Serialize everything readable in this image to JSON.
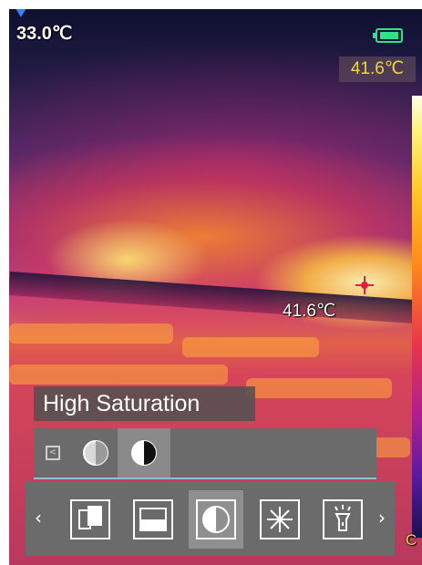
{
  "status": {
    "min_temp": "33.0℃",
    "max_temp": "41.6℃",
    "spot_temp": "41.6℃",
    "battery_icon": "battery-icon",
    "edge_fragment": "C"
  },
  "palette": {
    "label": "High Saturation"
  },
  "submenu": {
    "items": [
      {
        "name": "back-icon",
        "label": "<"
      },
      {
        "name": "half-contrast-icon"
      },
      {
        "name": "high-contrast-icon",
        "selected": true
      }
    ]
  },
  "toolbar": {
    "prev": "‹",
    "next": "›",
    "items": [
      {
        "name": "picture-in-picture-icon"
      },
      {
        "name": "split-screen-icon"
      },
      {
        "name": "palette-contrast-icon",
        "selected": true
      },
      {
        "name": "brightness-icon"
      },
      {
        "name": "flashlight-icon"
      }
    ]
  },
  "colors": {
    "accent_yellow": "#f2d53c",
    "menu_gray": "#6b6b6b",
    "selected_gray": "#8f8f8f"
  }
}
